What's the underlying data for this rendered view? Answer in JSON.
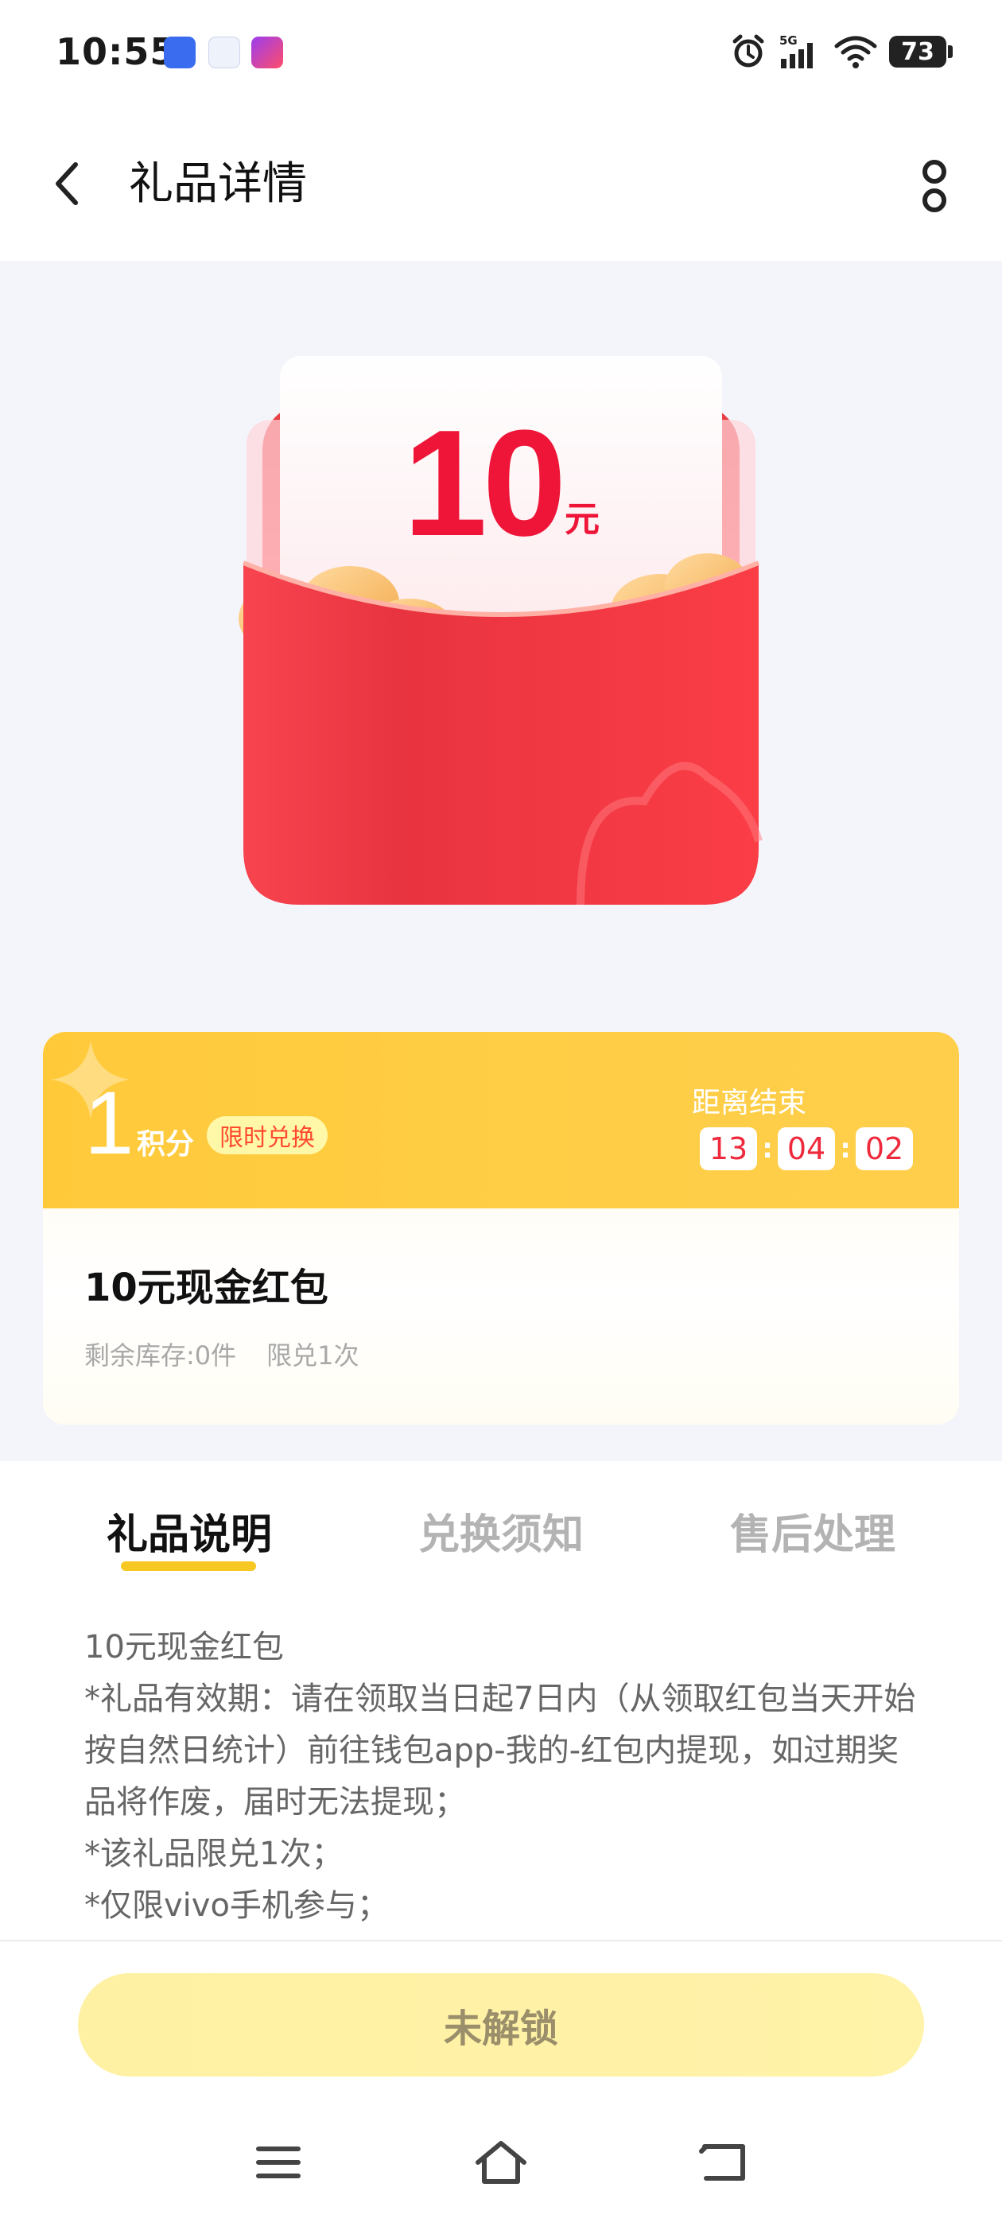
{
  "status_bar": {
    "time": "10:55",
    "network": "5G",
    "battery": "73",
    "apps": [
      "vivo",
      "message",
      "bank"
    ]
  },
  "header": {
    "title": "礼品详情",
    "back_icon": "chevron-left-icon",
    "more_icon": "more-vertical-icon"
  },
  "hero": {
    "amount": "10",
    "unit": "元"
  },
  "points_card": {
    "points": "1",
    "points_unit": "积分",
    "badge": "限时兑换",
    "countdown_label": "距离结束",
    "countdown": {
      "hours": "13",
      "minutes": "04",
      "seconds": "02"
    },
    "gift_name": "10元现金红包",
    "stock": "剩余库存:0件",
    "limit": "限兑1次"
  },
  "tabs": [
    {
      "label": "礼品说明",
      "active": true
    },
    {
      "label": "兑换须知",
      "active": false
    },
    {
      "label": "售后处理",
      "active": false
    }
  ],
  "description": [
    "10元现金红包",
    "*礼品有效期：请在领取当日起7日内（从领取红包当天开始按自然日统计）前往钱包app-我的-红包内提现，如过期奖品将作废，届时无法提现；",
    "*该礼品限兑1次；",
    "*仅限vivo手机参与；"
  ],
  "action_button": {
    "label": "未解锁"
  },
  "colors": {
    "accent_yellow": "#ffc93a",
    "red": "#ee1538",
    "button_bg": "#fff1a3",
    "hero_bg": "#f4f5fa"
  }
}
